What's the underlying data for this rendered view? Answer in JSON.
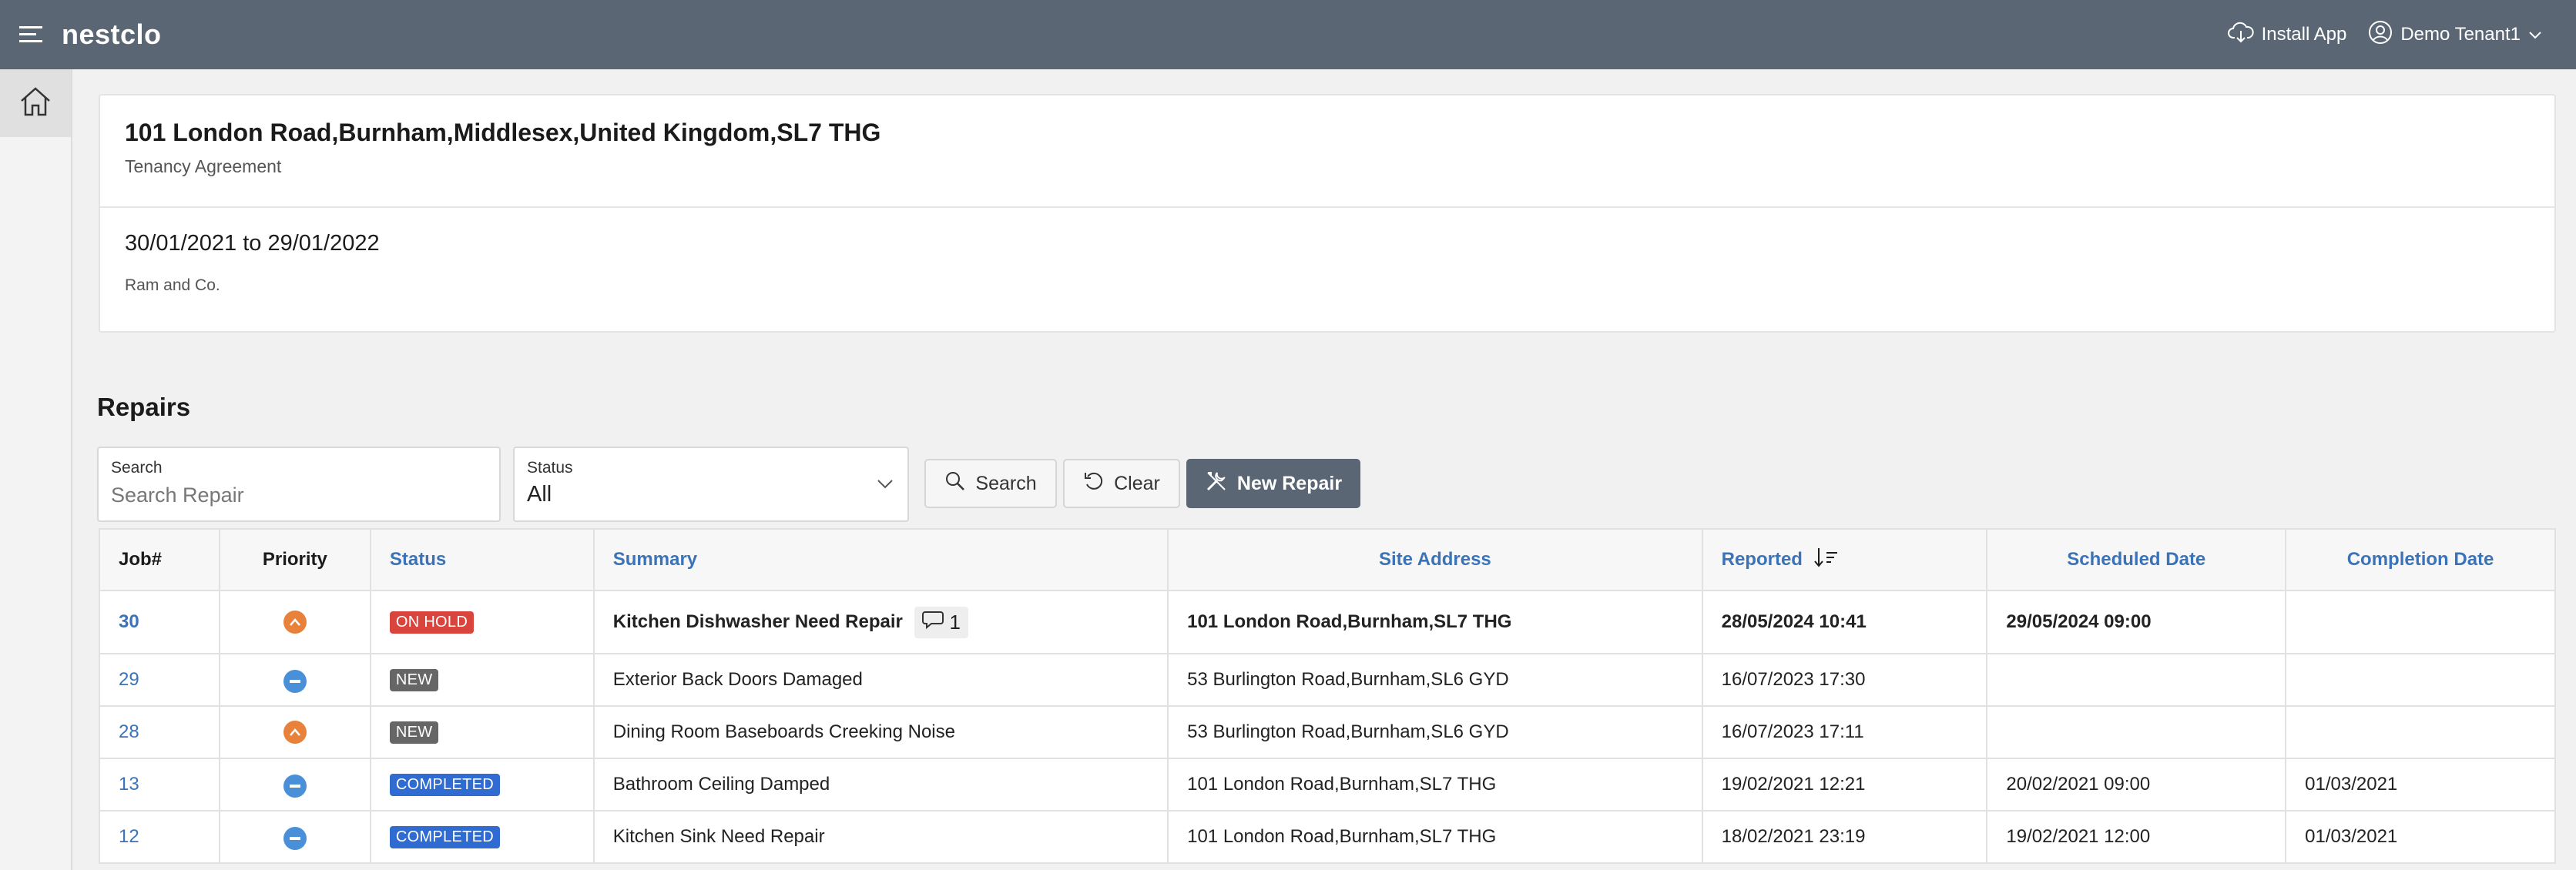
{
  "header": {
    "brand": "nestclo",
    "install_label": "Install App",
    "user_label": "Demo Tenant1",
    "bg_color": "#5b6675"
  },
  "tenancy": {
    "address": "101 London Road,Burnham,Middlesex,United Kingdom,SL7 THG",
    "type": "Tenancy Agreement",
    "date_range": "30/01/2021 to 29/01/2022",
    "landlord": "Ram and Co."
  },
  "repairs": {
    "title": "Repairs",
    "search": {
      "label": "Search",
      "placeholder": "Search Repair",
      "value": ""
    },
    "status": {
      "label": "Status",
      "value": "All"
    },
    "buttons": {
      "search": "Search",
      "clear": "Clear",
      "new_repair": "New Repair"
    },
    "columns": {
      "job": "Job#",
      "priority": "Priority",
      "status": "Status",
      "summary": "Summary",
      "site_address": "Site Address",
      "reported": "Reported",
      "scheduled": "Scheduled Date",
      "completion": "Completion Date"
    },
    "rows": [
      {
        "job": "30",
        "priority": "high",
        "status": "ON HOLD",
        "summary": "Kitchen Dishwasher Need Repair",
        "comments": "1",
        "site_address": "101 London Road,Burnham,SL7 THG",
        "reported": "28/05/2024 10:41",
        "scheduled": "29/05/2024 09:00",
        "completion": ""
      },
      {
        "job": "29",
        "priority": "medium",
        "status": "NEW",
        "summary": "Exterior Back Doors Damaged",
        "site_address": "53 Burlington Road,Burnham,SL6 GYD",
        "reported": "16/07/2023 17:30",
        "scheduled": "",
        "completion": ""
      },
      {
        "job": "28",
        "priority": "high",
        "status": "NEW",
        "summary": "Dining Room Baseboards Creeking Noise",
        "site_address": "53 Burlington Road,Burnham,SL6 GYD",
        "reported": "16/07/2023 17:11",
        "scheduled": "",
        "completion": ""
      },
      {
        "job": "13",
        "priority": "medium",
        "status": "COMPLETED",
        "summary": "Bathroom Ceiling Damped",
        "site_address": "101 London Road,Burnham,SL7 THG",
        "reported": "19/02/2021 12:21",
        "scheduled": "20/02/2021 09:00",
        "completion": "01/03/2021"
      },
      {
        "job": "12",
        "priority": "medium",
        "status": "COMPLETED",
        "summary": "Kitchen Sink Need Repair",
        "site_address": "101 London Road,Burnham,SL7 THG",
        "reported": "18/02/2021 23:19",
        "scheduled": "19/02/2021 12:00",
        "completion": "01/03/2021"
      }
    ],
    "colors": {
      "on_hold": "#d9453c",
      "new": "#666666",
      "completed": "#2f6bd1",
      "link": "#3b73b8",
      "priority_high": "#e8813a",
      "priority_medium": "#4a90d9"
    }
  }
}
